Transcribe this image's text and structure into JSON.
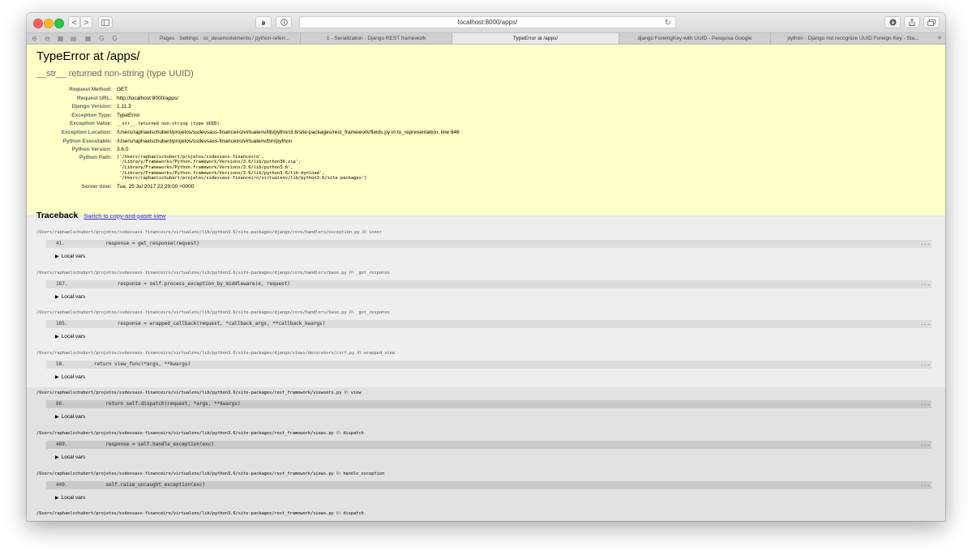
{
  "browser": {
    "url": "localhost:8000/apps/",
    "tabs": [
      "Pages · Settings · ss_desenvolvimento / python-referr...",
      "1 - Serialization - Django REST framework",
      "TypeError at /apps/",
      "django ForeingKey with UUID - Pesquisa Google",
      "python - Django not recognize UUID Foreign Key - Sta..."
    ],
    "active_tab": 2,
    "tab_plus": "+",
    "favorites": [
      "⊖",
      "⊖",
      "▦",
      "▤",
      "▦",
      "G",
      "G"
    ],
    "nav_back": "<",
    "nav_forward": ">",
    "reload": "↻"
  },
  "error": {
    "title": "TypeError at /apps/",
    "subtitle": "__str__ returned non-string (type UUID)"
  },
  "meta": [
    {
      "label": "Request Method:",
      "value": "GET",
      "mono": false
    },
    {
      "label": "Request URL:",
      "value": "http://localhost:8000/apps/",
      "mono": false
    },
    {
      "label": "Django Version:",
      "value": "1.11.3",
      "mono": false
    },
    {
      "label": "Exception Type:",
      "value": "TypeError",
      "mono": false
    },
    {
      "label": "Exception Value:",
      "value": "__str__ returned non-string (type UUID)",
      "mono": true
    },
    {
      "label": "Exception Location:",
      "value": "/Users/raphaelschubert/projetos/ssdevsass-financeiro/virtualenv/lib/python3.6/site-packages/rest_framework/fields.py in to_representation, line 846",
      "mono": false
    },
    {
      "label": "Python Executable:",
      "value": "/Users/raphaelschubert/projetos/ssdevsass-financeiro/virtualenv/bin/python",
      "mono": false
    },
    {
      "label": "Python Version:",
      "value": "3.6.0",
      "mono": false
    }
  ],
  "python_path": {
    "label": "Python Path:",
    "lines": [
      "['/Users/raphaelschubert/projetos/ssdevsass-financeiro',",
      " '/Library/Frameworks/Python.framework/Versions/3.6/lib/python36.zip',",
      " '/Library/Frameworks/Python.framework/Versions/3.6/lib/python3.6',",
      " '/Library/Frameworks/Python.framework/Versions/3.6/lib/python3.6/lib-dynload',",
      " '/Users/raphaelschubert/projetos/ssdevsass-financeiro/virtualenv/lib/python3.6/site-packages']"
    ]
  },
  "server_time": {
    "label": "Server time:",
    "value": "Tue, 25 Jul 2017 22:29:00 +0000"
  },
  "traceback": {
    "title": "Traceback",
    "switch_link": "Switch to copy-and-paste view",
    "in_word": "in",
    "local_vars": "Local vars",
    "ellipsis": "...",
    "frames": [
      {
        "path": "/Users/raphaelschubert/projetos/ssdevsass-financeiro/virtualenv/lib/python3.6/site-packages/django/core/handlers/exception.py",
        "func": "inner",
        "lineno": "41.",
        "code": "            response = get_response(request)",
        "user": false
      },
      {
        "path": "/Users/raphaelschubert/projetos/ssdevsass-financeiro/virtualenv/lib/python3.6/site-packages/django/core/handlers/base.py",
        "func": "_get_response",
        "lineno": "187.",
        "code": "                response = self.process_exception_by_middleware(e, request)",
        "user": false
      },
      {
        "path": "/Users/raphaelschubert/projetos/ssdevsass-financeiro/virtualenv/lib/python3.6/site-packages/django/core/handlers/base.py",
        "func": "_get_response",
        "lineno": "185.",
        "code": "                response = wrapped_callback(request, *callback_args, **callback_kwargs)",
        "user": false
      },
      {
        "path": "/Users/raphaelschubert/projetos/ssdevsass-financeiro/virtualenv/lib/python3.6/site-packages/django/views/decorators/csrf.py",
        "func": "wrapped_view",
        "lineno": "58.",
        "code": "        return view_func(*args, **kwargs)",
        "user": false
      },
      {
        "path": "/Users/raphaelschubert/projetos/ssdevsass-financeiro/virtualenv/lib/python3.6/site-packages/rest_framework/viewsets.py",
        "func": "view",
        "lineno": "86.",
        "code": "            return self.dispatch(request, *args, **kwargs)",
        "user": true
      },
      {
        "path": "/Users/raphaelschubert/projetos/ssdevsass-financeiro/virtualenv/lib/python3.6/site-packages/rest_framework/views.py",
        "func": "dispatch",
        "lineno": "489.",
        "code": "            response = self.handle_exception(exc)",
        "user": true
      },
      {
        "path": "/Users/raphaelschubert/projetos/ssdevsass-financeiro/virtualenv/lib/python3.6/site-packages/rest_framework/views.py",
        "func": "handle_exception",
        "lineno": "449.",
        "code": "            self.raise_uncaught_exception(exc)",
        "user": true
      },
      {
        "path": "/Users/raphaelschubert/projetos/ssdevsass-financeiro/virtualenv/lib/python3.6/site-packages/rest_framework/views.py",
        "func": "dispatch",
        "lineno": "",
        "code": "",
        "user": true
      }
    ]
  },
  "colors": {
    "summary_bg": "#ffffc8",
    "link": "#3333cc"
  }
}
